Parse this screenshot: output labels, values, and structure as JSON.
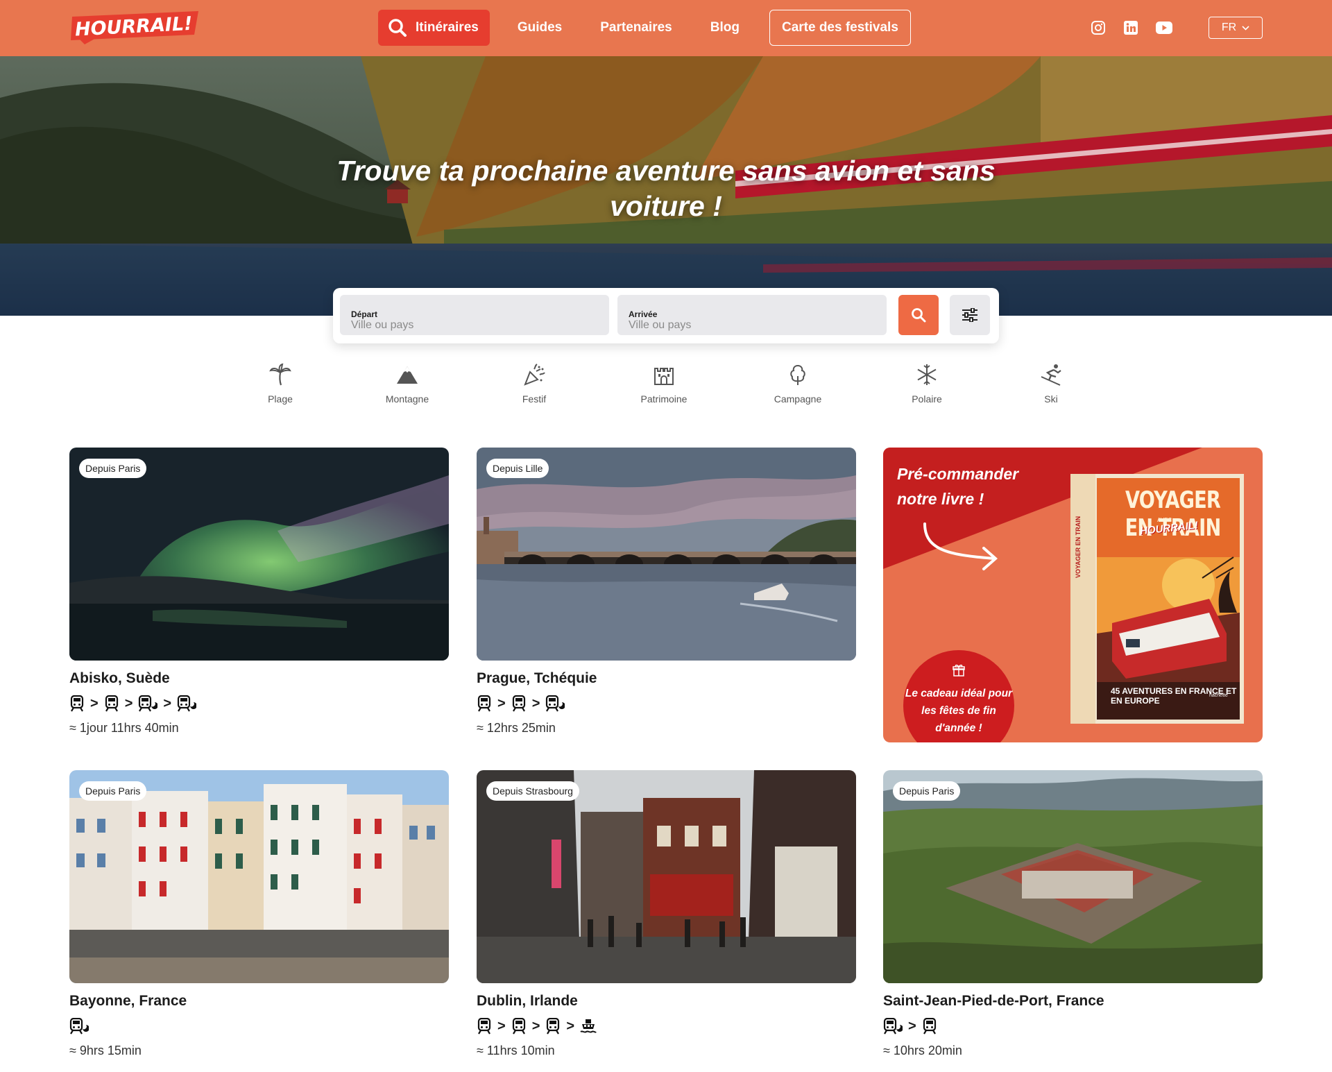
{
  "brand": {
    "logo_text": "HOURRAIL!"
  },
  "nav": {
    "items": [
      {
        "label": "Itinéraires",
        "active": true
      },
      {
        "label": "Guides"
      },
      {
        "label": "Partenaires"
      },
      {
        "label": "Blog"
      },
      {
        "label": "Carte des festivals",
        "outlined": true
      }
    ],
    "social_icons": [
      "instagram-icon",
      "linkedin-icon",
      "youtube-icon"
    ],
    "language": "FR"
  },
  "hero": {
    "title": "Trouve ta prochaine aventure sans avion et sans voiture !"
  },
  "search": {
    "departure": {
      "label": "Départ",
      "placeholder": "Ville ou pays",
      "value": ""
    },
    "arrival": {
      "label": "Arrivée",
      "placeholder": "Ville ou pays",
      "value": ""
    }
  },
  "categories": [
    {
      "label": "Plage",
      "icon": "palm-tree-icon"
    },
    {
      "label": "Montagne",
      "icon": "mountain-icon"
    },
    {
      "label": "Festif",
      "icon": "party-popper-icon"
    },
    {
      "label": "Patrimoine",
      "icon": "castle-icon"
    },
    {
      "label": "Campagne",
      "icon": "tree-icon"
    },
    {
      "label": "Polaire",
      "icon": "snowflake-icon"
    },
    {
      "label": "Ski",
      "icon": "skier-icon"
    }
  ],
  "destinations": [
    {
      "badge": "Depuis Paris",
      "title": "Abisko, Suède",
      "route": [
        "train",
        "train",
        "night-train",
        "night-train"
      ],
      "duration": "≈ 1jour 11hrs 40min"
    },
    {
      "badge": "Depuis Lille",
      "title": "Prague, Tchéquie",
      "route": [
        "train",
        "train",
        "night-train"
      ],
      "duration": "≈ 12hrs 25min"
    },
    {
      "badge": "Depuis Paris",
      "title": "Bayonne, France",
      "route": [
        "night-train"
      ],
      "duration": "≈ 9hrs 15min"
    },
    {
      "badge": "Depuis Strasbourg",
      "title": "Dublin, Irlande",
      "route": [
        "train",
        "train",
        "train",
        "ferry"
      ],
      "duration": "≈ 11hrs 10min"
    },
    {
      "badge": "Depuis Paris",
      "title": "Saint-Jean-Pied-de-Port, France",
      "route": [
        "night-train",
        "train"
      ],
      "duration": "≈ 10hrs 20min"
    }
  ],
  "promo": {
    "title": "Pré-commander notre livre !",
    "gift_text": "Le cadeau idéal pour les fêtes de fin d'année !",
    "book_title": "VOYAGER EN TRAIN",
    "book_avec": "AVEC",
    "book_brand": "HOURRAIL!",
    "book_count": "45 AVENTURES EN FRANCE ET EN EUROPE",
    "book_publisher": "hachette",
    "book_spine": "VOYAGER EN TRAIN"
  },
  "colors": {
    "primary": "#e8764f",
    "accent_red": "#e63d2f",
    "dark_red": "#cd1d1f",
    "search_button": "#ee6a44"
  }
}
